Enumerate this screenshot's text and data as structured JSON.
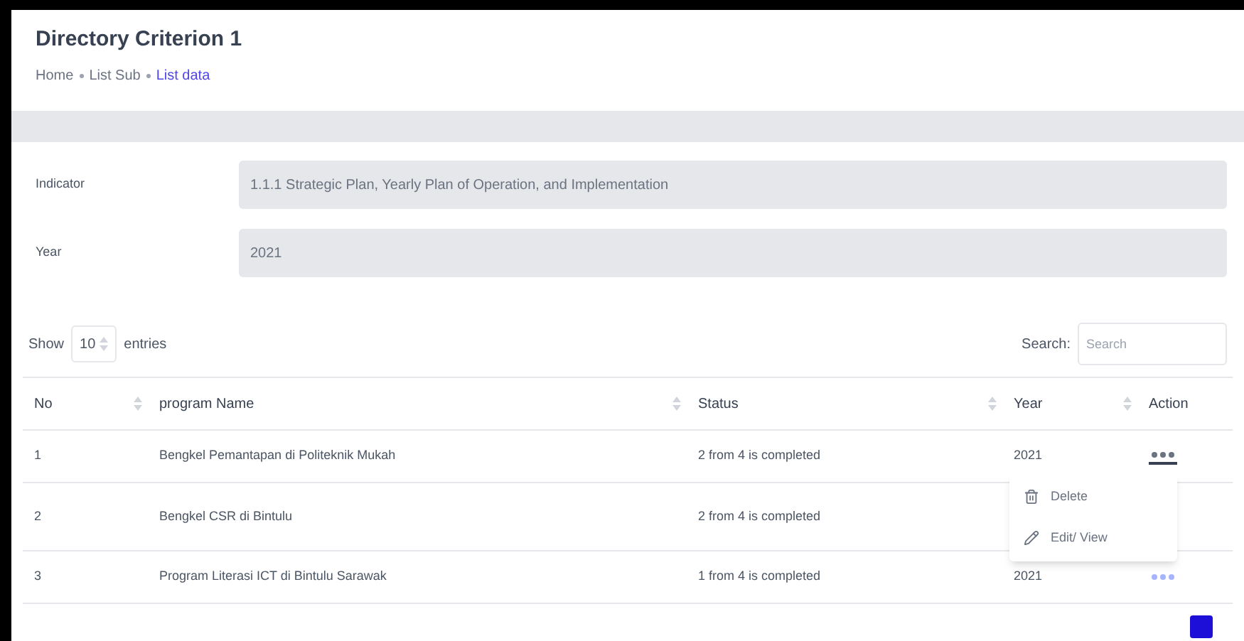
{
  "header": {
    "title": "Directory Criterion 1",
    "breadcrumb": [
      {
        "label": "Home",
        "selected": false
      },
      {
        "label": "List Sub",
        "selected": false
      },
      {
        "label": "List data",
        "selected": true
      }
    ]
  },
  "form": [
    {
      "label": "Indicator",
      "value": "1.1.1 Strategic Plan, Yearly Plan of Operation, and Implementation"
    },
    {
      "label": "Year",
      "value": "2021"
    }
  ],
  "length": {
    "before": "Show",
    "value": "10",
    "after": "entries"
  },
  "search": {
    "label": "Search:",
    "placeholder": "Search"
  },
  "table": {
    "columns": [
      "No",
      "program Name",
      "Status",
      "Year",
      "Action"
    ],
    "rows": [
      {
        "no": "1",
        "name": "Bengkel Pemantapan di Politeknik Mukah",
        "status": "2 from 4 is completed",
        "year": "2021",
        "menu_open": true
      },
      {
        "no": "2",
        "name": "Bengkel CSR di Bintulu",
        "status": "2 from 4 is completed",
        "menu_open": false
      },
      {
        "no": "3",
        "name": "Program Literasi ICT di Bintulu Sarawak",
        "status": "1 from 4 is completed",
        "year": "2021",
        "menu_open": false
      }
    ]
  },
  "action_menu": [
    {
      "kind": "delete",
      "label": "Delete"
    },
    {
      "kind": "edit",
      "label": "Edit/ View"
    }
  ]
}
